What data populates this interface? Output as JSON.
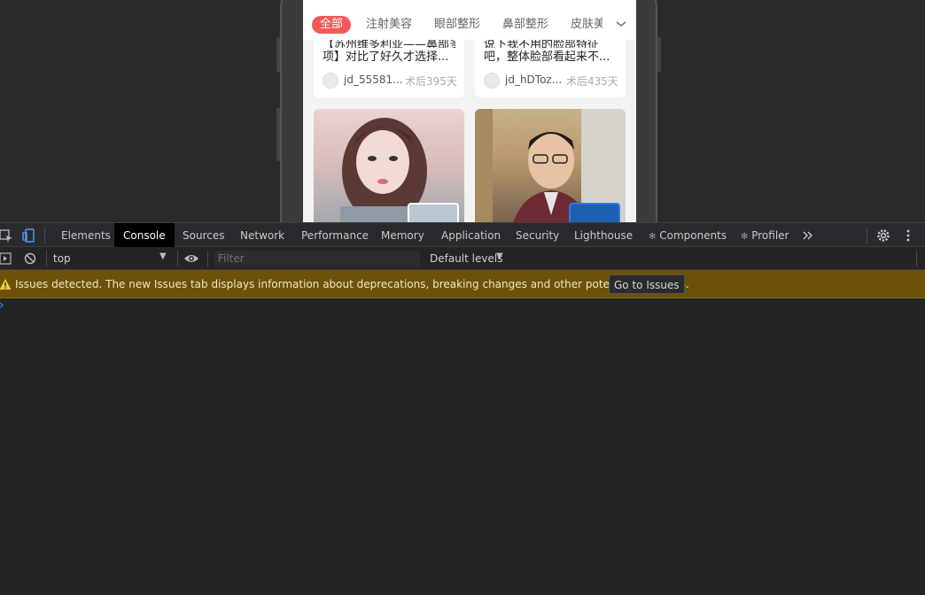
{
  "app": {
    "tabs": [
      {
        "label": "全部",
        "active": true
      },
      {
        "label": "注射美容",
        "active": false
      },
      {
        "label": "眼部整形",
        "active": false
      },
      {
        "label": "鼻部整形",
        "active": false
      },
      {
        "label": "皮肤美",
        "active": false
      }
    ],
    "cards": [
      {
        "title_line1": "【苏州维多利亚——鼻部多",
        "title_line2": "项】对比了好久才选择...",
        "user": "jd_55581...",
        "time": "术后395天"
      },
      {
        "title_line1": "说下我不用的脸部特征",
        "title_line2": "吧，整体脸部看起来不...",
        "user": "jd_hDToz...",
        "time": "术后435天"
      }
    ]
  },
  "devtools": {
    "tabs": [
      {
        "label": "Elements",
        "active": false
      },
      {
        "label": "Console",
        "active": true
      },
      {
        "label": "Sources",
        "active": false
      },
      {
        "label": "Network",
        "active": false
      },
      {
        "label": "Performance",
        "active": false
      },
      {
        "label": "Memory",
        "active": false
      },
      {
        "label": "Application",
        "active": false
      },
      {
        "label": "Security",
        "active": false
      },
      {
        "label": "Lighthouse",
        "active": false
      },
      {
        "label": "Components",
        "active": false
      },
      {
        "label": "Profiler",
        "active": false
      }
    ],
    "overflow_icon": "chevron-double-right-icon",
    "context": "top",
    "filter_placeholder": "Filter",
    "levels": "Default levels",
    "issues_text": "Issues detected. The new Issues tab displays information about deprecations, breaking changes and other potential problems.",
    "issues_button": "Go to Issues",
    "prompt_symbol": "›",
    "colors": {
      "accent": "#f15a58",
      "warning_bg": "#6b5208",
      "prompt": "#4d9cf8"
    }
  }
}
